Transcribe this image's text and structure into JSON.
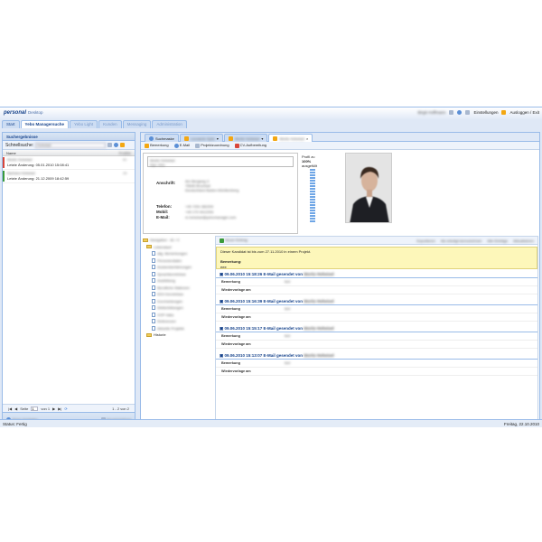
{
  "app": {
    "logo": "personal",
    "logo_sub": "Desktop",
    "user_name": "Birgit Hoffmann",
    "settings_label": "Einstellungen",
    "logout_label": "Ausloggen / Exit"
  },
  "main_tabs": [
    "Start",
    "Yebo Managersuche",
    "Yebo Light",
    "Kunden",
    "Messaging",
    "Administration"
  ],
  "left_panel": {
    "title": "Suchergebnisse",
    "quick_label": "Schnellsuche:",
    "quick_value": "Hoheisel",
    "col_name": "Name",
    "col_nr": "ProfilNr",
    "results": [
      {
        "name": "Moritz Hoheisel",
        "nr": "81",
        "changed": "Letzte Änderung: 05.01.2010 15:08:41",
        "color": "#d8463a"
      },
      {
        "name": "Barbara Hoheisel",
        "nr": "26",
        "changed": "Letzte Änderung: 21.12.2009 18:42:59",
        "color": "#3a9a3a"
      }
    ],
    "pager": {
      "page_label": "Seite",
      "page_value": "1",
      "of_label": "von 1",
      "range": "1 - 2 von 2"
    },
    "foot_left": "Ziege Vorstellen",
    "foot_right": "Neuanmeldung"
  },
  "subtabs": [
    "Suchmaske",
    "Leonardo Spitz",
    "Moritz Hoheisel",
    "Moritz Hoheisel"
  ],
  "actions": [
    "Bemerkung",
    "E-Mail",
    "Projektzuordnung",
    "CV-Aufbereitung"
  ],
  "candidate": {
    "name": "Moritz Hoheisel",
    "title": "Dipl.-Kfm.",
    "anschrift_label": "Anschrift:",
    "address_1": "Am Bergweg 3",
    "address_2": "76646 Bruchsal",
    "address_3": "Deutschland Baden-Württemberg",
    "telefon_label": "Telefon:",
    "telefon": "+49 7251 982200",
    "mobil_label": "Mobil:",
    "mobil": "+49 170 4412293",
    "email_label": "E-Mail:",
    "email": "m.hoheisel@yebomanager.com",
    "profil_label": "Profil zu",
    "profil_pct": "100%",
    "profil_suffix": "ausgefüllt"
  },
  "tree": {
    "root": "Navigation - 81 / 0",
    "folder": "Lebenslauf",
    "items": [
      "allg. Bemerkungen",
      "Personendaten",
      "Auslandserfahrungen",
      "Sprachkenntnisse",
      "Ausbildung",
      "Berufliche Stationen",
      "EDV-Kenntnisse",
      "Kurzmeldungen",
      "Weiterbildungen",
      "VOP-Vaks",
      "Referenzen",
      "Aktuelle Projekte"
    ],
    "historie": "Historie"
  },
  "entries_bar": {
    "new": "Neuer Eintrag",
    "print": "Exportieren",
    "mark": "Als erledigt kennzeichnen",
    "show": "Alle Einträge",
    "delete": "Aktualisieren"
  },
  "notice": {
    "text": "Dieser Kandidat ist bis zum 27.11.2010 in einem Projekt.",
    "remark_label": "Bemerkung:",
    "remark": "eee"
  },
  "entries": [
    {
      "head": "09.06.2010 15:18:26 E-Mail gesendet von",
      "author": "Moritz Hoheisel"
    },
    {
      "head": "09.06.2010 15:16:39 E-Mail gesendet von",
      "author": "Moritz Hoheisel"
    },
    {
      "head": "09.06.2010 15:15:17 E-Mail gesendet von",
      "author": "Moritz Hoheisel"
    },
    {
      "head": "09.06.2010 15:13:07 E-Mail gesendet von",
      "author": "Moritz Hoheisel"
    }
  ],
  "entry_fields": {
    "remark": "Bemerkung",
    "remark_val": "test",
    "resubmit": "Wiedervorlage am"
  },
  "status": {
    "left": "Status: Fertig",
    "right": "Freitag, 22.10.2010"
  }
}
